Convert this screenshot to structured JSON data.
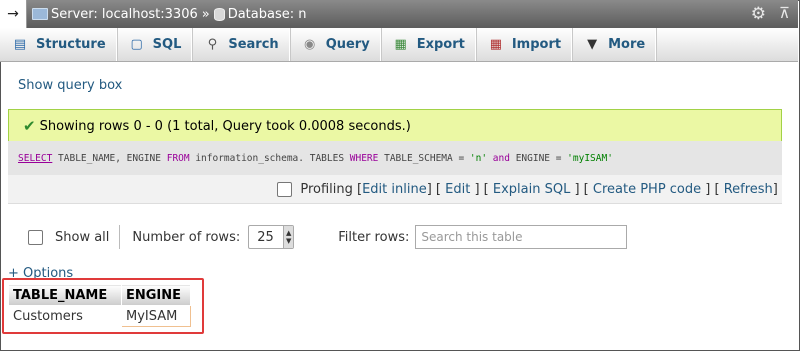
{
  "breadcrumb": {
    "server_label": "Server: localhost:3306",
    "separator": "»",
    "database_label": "Database: n",
    "back_icon": "arrow-right-icon",
    "settings_icon": "gear-icon",
    "collapse_icon": "collapse-icon"
  },
  "tabs": [
    {
      "label": "Structure",
      "icon": "structure-icon"
    },
    {
      "label": "SQL",
      "icon": "sql-icon"
    },
    {
      "label": "Search",
      "icon": "search-icon"
    },
    {
      "label": "Query",
      "icon": "query-icon"
    },
    {
      "label": "Export",
      "icon": "export-icon"
    },
    {
      "label": "Import",
      "icon": "import-icon"
    },
    {
      "label": "More",
      "icon": "chevron-down-icon"
    }
  ],
  "show_query_box": "Show query box",
  "success": {
    "message": "Showing rows 0 - 0 (1 total, Query took 0.0008 seconds.)"
  },
  "query": {
    "select": "SELECT",
    "part1": " TABLE_NAME, ENGINE ",
    "from": "FROM",
    "part2": " information_schema. TABLES ",
    "where": "WHERE",
    "part3": " TABLE_SCHEMA = ",
    "str1": "'n'",
    "and": "and",
    "part4": " ENGINE = ",
    "str2": "'myISAM'"
  },
  "query_toolbar": {
    "profiling": "Profiling",
    "edit_inline": "Edit inline",
    "edit": "Edit",
    "explain_sql": "Explain SQL",
    "create_php_code": "Create PHP code",
    "refresh": "Refresh"
  },
  "navigation": {
    "show_all": "Show all",
    "number_of_rows_label": "Number of rows:",
    "number_of_rows_value": "25",
    "filter_label": "Filter rows:",
    "filter_placeholder": "Search this table"
  },
  "options_link": "+ Options",
  "results": {
    "columns": [
      "TABLE_NAME",
      "ENGINE"
    ],
    "rows": [
      [
        "Customers",
        "MyISAM"
      ]
    ]
  }
}
